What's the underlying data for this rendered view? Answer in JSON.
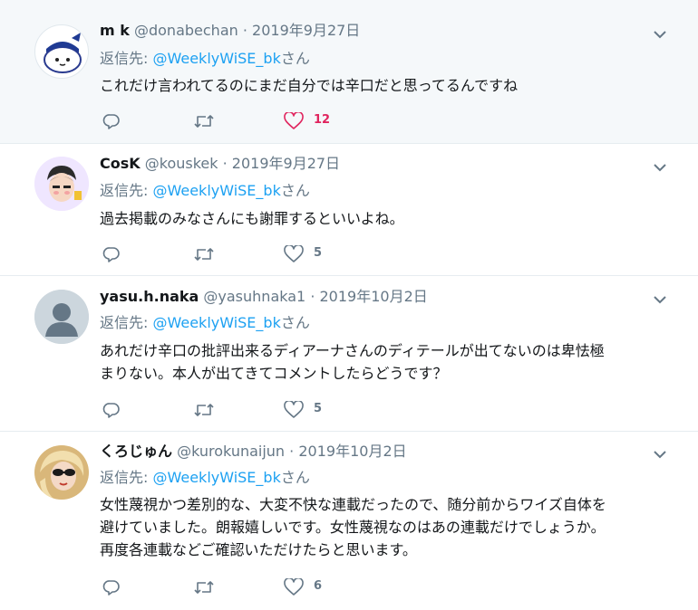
{
  "tweets": [
    {
      "name": "m k",
      "handle": "@donabechan",
      "date": "2019年9月27日",
      "reply_prefix": "返信先: ",
      "reply_to": "@WeeklyWiSE_bk",
      "reply_suffix": "さん",
      "text": "これだけ言われてるのにまだ自分では辛口だと思ってるんですね",
      "likes": "12",
      "liked": true
    },
    {
      "name": "CosK",
      "handle": "@kouskek",
      "date": "2019年9月27日",
      "reply_prefix": "返信先: ",
      "reply_to": "@WeeklyWiSE_bk",
      "reply_suffix": "さん",
      "text": "過去掲載のみなさんにも謝罪するといいよね。",
      "likes": "5",
      "liked": false
    },
    {
      "name": "yasu.h.naka",
      "handle": "@yasuhnaka1",
      "date": "2019年10月2日",
      "reply_prefix": "返信先: ",
      "reply_to": "@WeeklyWiSE_bk",
      "reply_suffix": "さん",
      "text": "あれだけ辛口の批評出来るディアーナさんのディテールが出てないのは卑怯極\nまりない。本人が出てきてコメントしたらどうです？",
      "likes": "5",
      "liked": false
    },
    {
      "name": "くろじゅん",
      "handle": "@kurokunaijun",
      "date": "2019年10月2日",
      "reply_prefix": "返信先: ",
      "reply_to": "@WeeklyWiSE_bk",
      "reply_suffix": "さん",
      "text": "女性蔑視かつ差別的な、大変不快な連載だったので、随分前からワイズ自体を\n避けていました。朗報嬉しいです。女性蔑視なのはあの連載だけでしょうか。\n再度各連載などご確認いただけたらと思います。",
      "likes": "6",
      "liked": false
    }
  ],
  "separator": "·",
  "icons": [
    "reply-icon",
    "retweet-icon",
    "like-icon",
    "chevron-down-icon"
  ],
  "colors": {
    "accent": "#1da1f2",
    "like": "#e0245e",
    "muted": "#657786",
    "highlight_bg": "#f5f8fa"
  }
}
